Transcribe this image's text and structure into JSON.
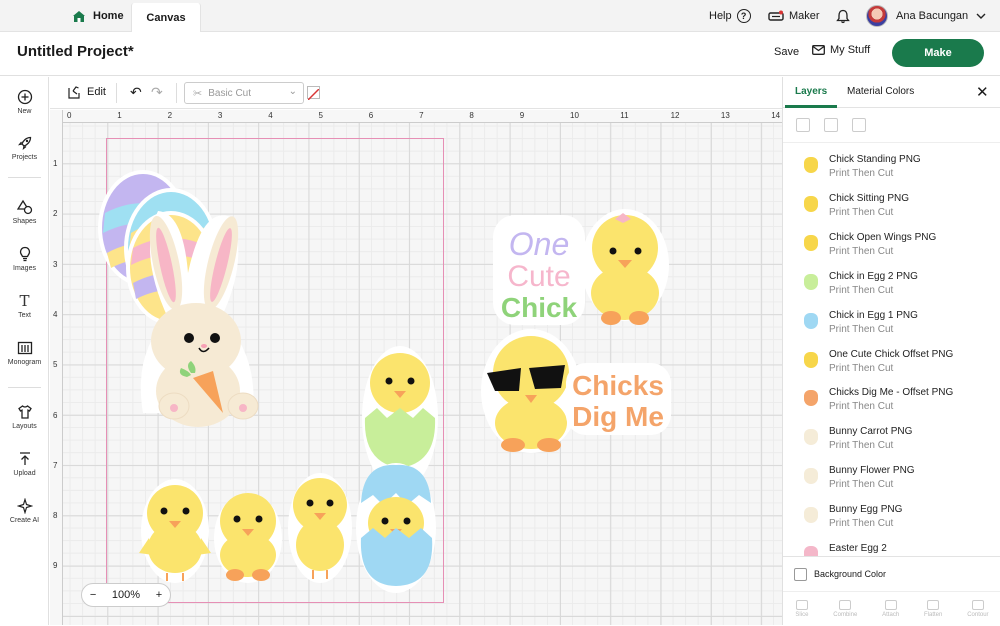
{
  "topbar": {
    "home_label": "Home",
    "canvas_label": "Canvas",
    "help_label": "Help",
    "help_icon": "?",
    "maker_label": "Maker",
    "user_name": "Ana Bacungan"
  },
  "titlebar": {
    "project_title": "Untitled Project*",
    "save_label": "Save",
    "mystuff_label": "My Stuff",
    "make_label": "Make"
  },
  "leftbar": {
    "items": [
      {
        "label": "New",
        "icon": "plus-circle-icon"
      },
      {
        "label": "Projects",
        "icon": "rocket-icon"
      },
      {
        "label": "Shapes",
        "icon": "shapes-icon"
      },
      {
        "label": "Images",
        "icon": "bulb-icon"
      },
      {
        "label": "Text",
        "icon": "text-icon"
      },
      {
        "label": "Monogram",
        "icon": "monogram-icon"
      },
      {
        "label": "Layouts",
        "icon": "shirt-icon"
      },
      {
        "label": "Upload",
        "icon": "upload-icon"
      },
      {
        "label": "Create AI",
        "icon": "sparkle-icon"
      }
    ]
  },
  "edittoolbar": {
    "edit_label": "Edit",
    "operation_value": "Basic Cut"
  },
  "rulers": {
    "top": [
      "0",
      "1",
      "2",
      "3",
      "4",
      "5",
      "6",
      "7",
      "8",
      "9",
      "10",
      "11",
      "12",
      "13",
      "14"
    ],
    "left": [
      "1",
      "2",
      "3",
      "4",
      "5",
      "6",
      "7",
      "8",
      "9"
    ]
  },
  "canvas": {
    "zoom_value": "100%",
    "zoom_minus": "−",
    "zoom_plus": "+",
    "sticker_one": "One",
    "sticker_cute": "Cute",
    "sticker_chick": "Chick",
    "sticker_chicks": "Chicks",
    "sticker_dig_me": "Dig Me"
  },
  "layers_panel": {
    "tab_layers": "Layers",
    "tab_material_colors": "Material Colors",
    "layers": [
      {
        "name": "Chick Standing PNG",
        "operation": "Print Then Cut",
        "thumb": "#f7d64a"
      },
      {
        "name": "Chick Sitting PNG",
        "operation": "Print Then Cut",
        "thumb": "#f7d64a"
      },
      {
        "name": "Chick Open Wings PNG",
        "operation": "Print Then Cut",
        "thumb": "#f7d64a"
      },
      {
        "name": "Chick in Egg 2 PNG",
        "operation": "Print Then Cut",
        "thumb": "#c8ee9a"
      },
      {
        "name": "Chick in Egg 1 PNG",
        "operation": "Print Then Cut",
        "thumb": "#9fd8f3"
      },
      {
        "name": "One Cute Chick Offset PNG",
        "operation": "Print Then Cut",
        "thumb": "#f7d64a"
      },
      {
        "name": "Chicks Dig Me - Offset PNG",
        "operation": "Print Then Cut",
        "thumb": "#f4a46a"
      },
      {
        "name": "Bunny Carrot PNG",
        "operation": "Print Then Cut",
        "thumb": "#f5ecd8"
      },
      {
        "name": "Bunny Flower PNG",
        "operation": "Print Then Cut",
        "thumb": "#f5ecd8"
      },
      {
        "name": "Bunny Egg PNG",
        "operation": "Print Then Cut",
        "thumb": "#f5ecd8"
      },
      {
        "name": "Easter Egg 2",
        "operation": "Print Then Cut",
        "thumb": "#f4b7c9"
      }
    ],
    "background_color_label": "Background Color",
    "bottom_tools": [
      "Slice",
      "Combine",
      "Attach",
      "Flatten",
      "Contour"
    ]
  },
  "colors": {
    "accent": "#1a7a4c",
    "mat_border": "#e68fb5",
    "chick": "#f7d64a"
  }
}
